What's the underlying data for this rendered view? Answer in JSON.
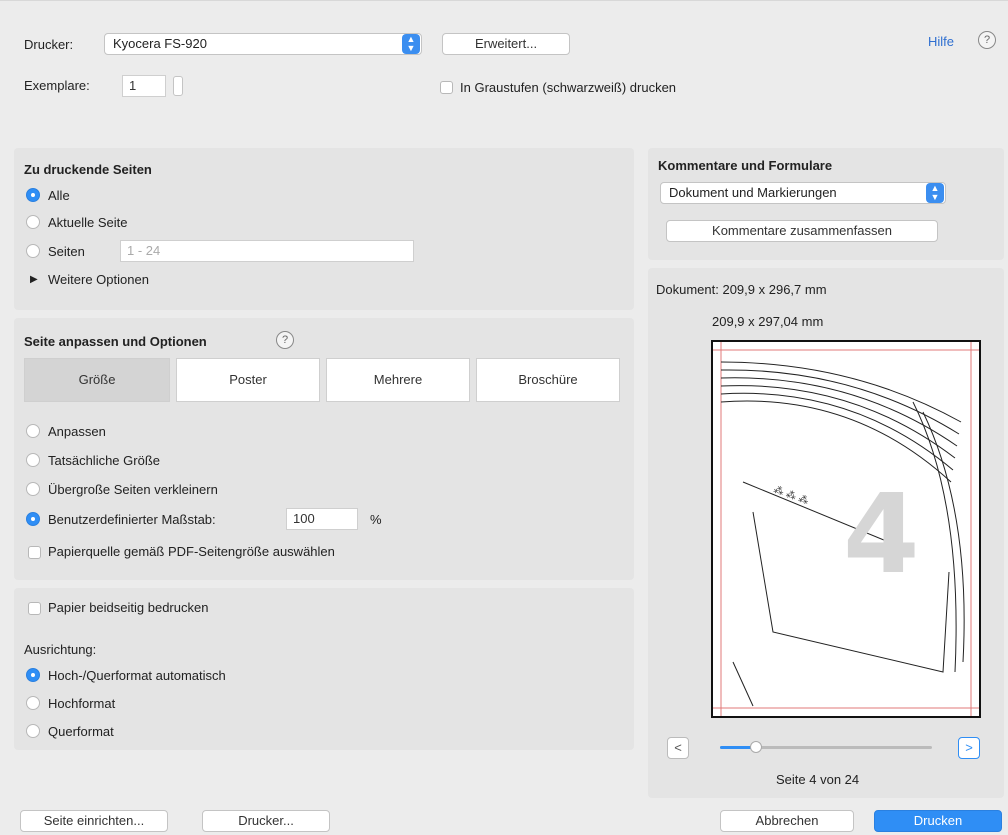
{
  "header": {
    "printer_label": "Drucker:",
    "printer_value": "Kyocera FS-920",
    "advanced_button": "Erweitert...",
    "copies_label": "Exemplare:",
    "copies_value": "1",
    "grayscale_label": "In Graustufen (schwarzweiß) drucken",
    "help_link": "Hilfe",
    "help_icon": "question-icon"
  },
  "pages": {
    "heading": "Zu druckende Seiten",
    "options": [
      "Alle",
      "Aktuelle Seite",
      "Seiten"
    ],
    "selected": "Alle",
    "pages_placeholder": "1 - 24",
    "more_options": "Weitere Optionen"
  },
  "sizing": {
    "heading": "Seite anpassen und Optionen",
    "tabs": [
      "Größe",
      "Poster",
      "Mehrere",
      "Broschüre"
    ],
    "selected_tab": "Größe",
    "options": [
      "Anpassen",
      "Tatsächliche Größe",
      "Übergroße Seiten verkleinern",
      "Benutzerdefinierter Maßstab:"
    ],
    "selected": "Benutzerdefinierter Maßstab:",
    "scale_value": "100",
    "scale_unit": "%",
    "paper_source_label": "Papierquelle gemäß PDF-Seitengröße auswählen"
  },
  "duplex": {
    "label": "Papier beidseitig bedrucken",
    "orientation_heading": "Ausrichtung:",
    "orientation_options": [
      "Hoch-/Querformat automatisch",
      "Hochformat",
      "Querformat"
    ],
    "orientation_selected": "Hoch-/Querformat automatisch"
  },
  "comments": {
    "heading": "Kommentare und Formulare",
    "select_value": "Dokument und Markierungen",
    "summarize_button": "Kommentare zusammenfassen"
  },
  "preview": {
    "document_size": "Dokument: 209,9 x 296,7 mm",
    "page_size": "209,9 x 297,04 mm",
    "page_number_watermark": "4",
    "page_indicator": "Seite 4 von 24",
    "prev_label": "<",
    "next_label": ">",
    "progress": 0.17
  },
  "footer": {
    "page_setup_button": "Seite einrichten...",
    "printer_button": "Drucker...",
    "cancel_button": "Abbrechen",
    "print_button": "Drucken"
  },
  "colors": {
    "accent": "#2f8ef5",
    "link": "#2f6fd0"
  }
}
